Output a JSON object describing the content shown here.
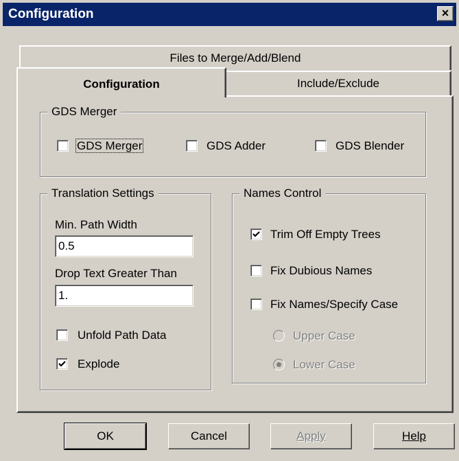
{
  "window": {
    "title": "Configuration"
  },
  "tabs": {
    "files": "Files to Merge/Add/Blend",
    "configuration": "Configuration",
    "include": "Include/Exclude"
  },
  "gds_group": {
    "legend": "GDS Merger",
    "merger": {
      "label": "GDS Merger",
      "checked": false
    },
    "adder": {
      "label": "GDS Adder",
      "checked": false
    },
    "blender": {
      "label": "GDS Blender",
      "checked": false
    }
  },
  "translation": {
    "legend": "Translation Settings",
    "min_path_width": {
      "label": "Min. Path Width",
      "value": "0.5"
    },
    "drop_text": {
      "label": "Drop Text Greater Than",
      "value": "1."
    },
    "unfold": {
      "label": "Unfold Path Data",
      "checked": false
    },
    "explode": {
      "label": "Explode",
      "checked": true
    }
  },
  "names": {
    "legend": "Names Control",
    "trim": {
      "label": "Trim Off Empty Trees",
      "checked": true
    },
    "dubious": {
      "label": "Fix Dubious Names",
      "checked": false
    },
    "specify_case": {
      "label": "Fix Names/Specify Case",
      "checked": false
    },
    "upper": {
      "label": "Upper Case",
      "selected": false,
      "enabled": false
    },
    "lower": {
      "label": "Lower Case",
      "selected": true,
      "enabled": false
    }
  },
  "buttons": {
    "ok": "OK",
    "cancel": "Cancel",
    "apply": "Apply",
    "help": "Help"
  }
}
